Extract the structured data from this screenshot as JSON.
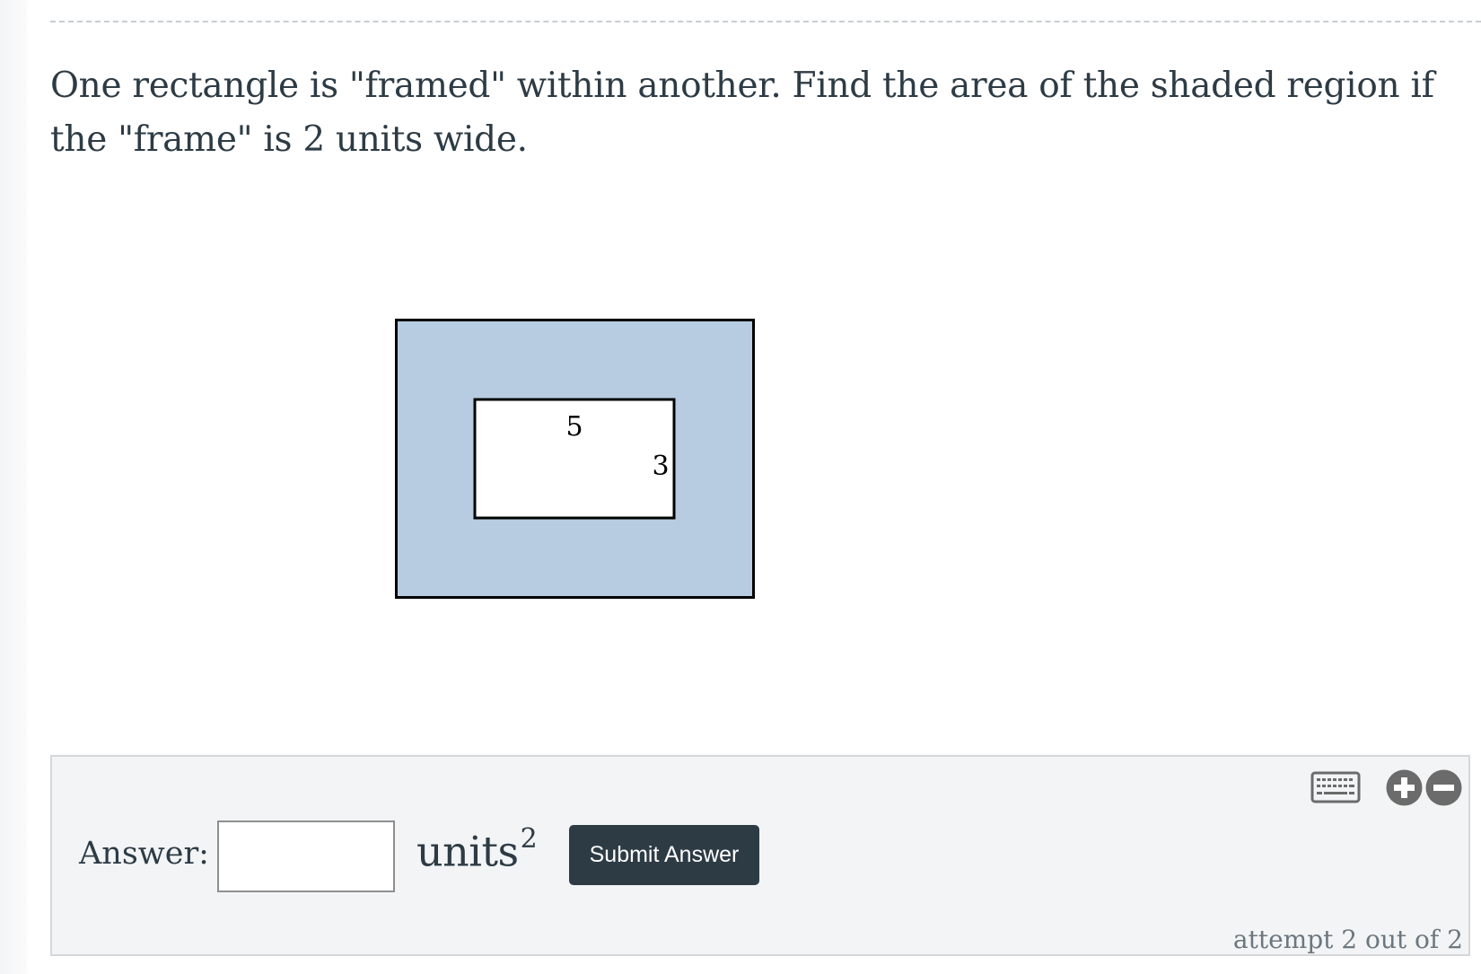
{
  "question": {
    "text": "One rectangle is \"framed\" within another. Find the area of the shaded region if the \"frame\" is 2 units wide."
  },
  "figure": {
    "inner_width_label": "5",
    "inner_height_label": "3",
    "shade_color": "#b7cce0",
    "stroke_color": "#000000"
  },
  "answer": {
    "label": "Answer:",
    "input_value": "",
    "units_text": "units",
    "units_exponent": "2",
    "submit_label": "Submit Answer",
    "attempt_text": "attempt 2 out of 2"
  },
  "icons": {
    "keyboard": "keyboard-icon",
    "zoom_in": "plus-circle-icon",
    "zoom_out": "minus-circle-icon"
  },
  "colors": {
    "text": "#2d3b45",
    "button_bg": "#2d3b45",
    "icon_gray": "#6b6b6b",
    "panel_bg": "#f3f4f5"
  }
}
